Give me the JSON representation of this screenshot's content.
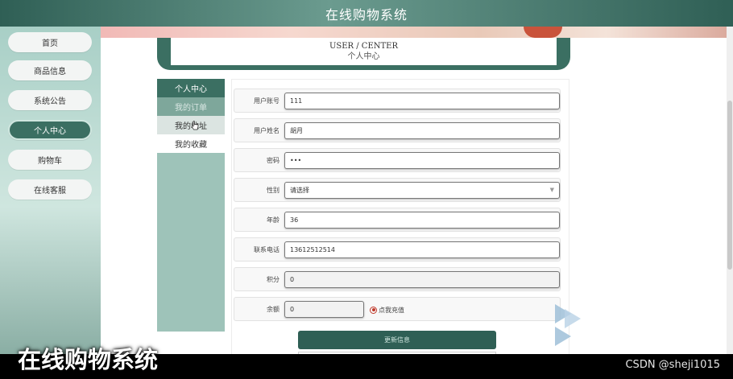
{
  "header": {
    "title": "在线购物系统"
  },
  "nav": {
    "items": [
      {
        "label": "首页",
        "active": false
      },
      {
        "label": "商品信息",
        "active": false
      },
      {
        "label": "系统公告",
        "active": false
      },
      {
        "label": "个人中心",
        "active": true
      },
      {
        "label": "购物车",
        "active": false
      },
      {
        "label": "在线客服",
        "active": false
      }
    ]
  },
  "center": {
    "title_en": "USER / CENTER",
    "title_cn": "个人中心"
  },
  "submenu": {
    "head": "个人中心",
    "items": [
      "我的订单",
      "我的地址",
      "我的收藏"
    ]
  },
  "form": {
    "fields": [
      {
        "label": "用户账号",
        "value": "111"
      },
      {
        "label": "用户姓名",
        "value": "胡月"
      },
      {
        "label": "密码",
        "value": "•••"
      },
      {
        "label": "性别",
        "value": "请选择"
      },
      {
        "label": "年龄",
        "value": "36"
      },
      {
        "label": "联系电话",
        "value": "13612512514"
      },
      {
        "label": "积分",
        "value": "0"
      },
      {
        "label": "余额",
        "value": "0"
      }
    ],
    "recharge_label": "点我充值",
    "update_button": "更新信息"
  },
  "overlay": {
    "watermark_left": "在线购物系统",
    "watermark_right": "CSDN @sheji1015"
  },
  "colors": {
    "accent": "#3b6f62",
    "header": "#2f5f55",
    "nav_bg": "#a8cfc6",
    "radio": "#c0392b"
  },
  "icons": {
    "cursor": "hand-cursor-icon",
    "select_arrow": "chevron-down-icon",
    "radio": "radio-selected-icon",
    "deco": "double-arrow-right-icon"
  }
}
